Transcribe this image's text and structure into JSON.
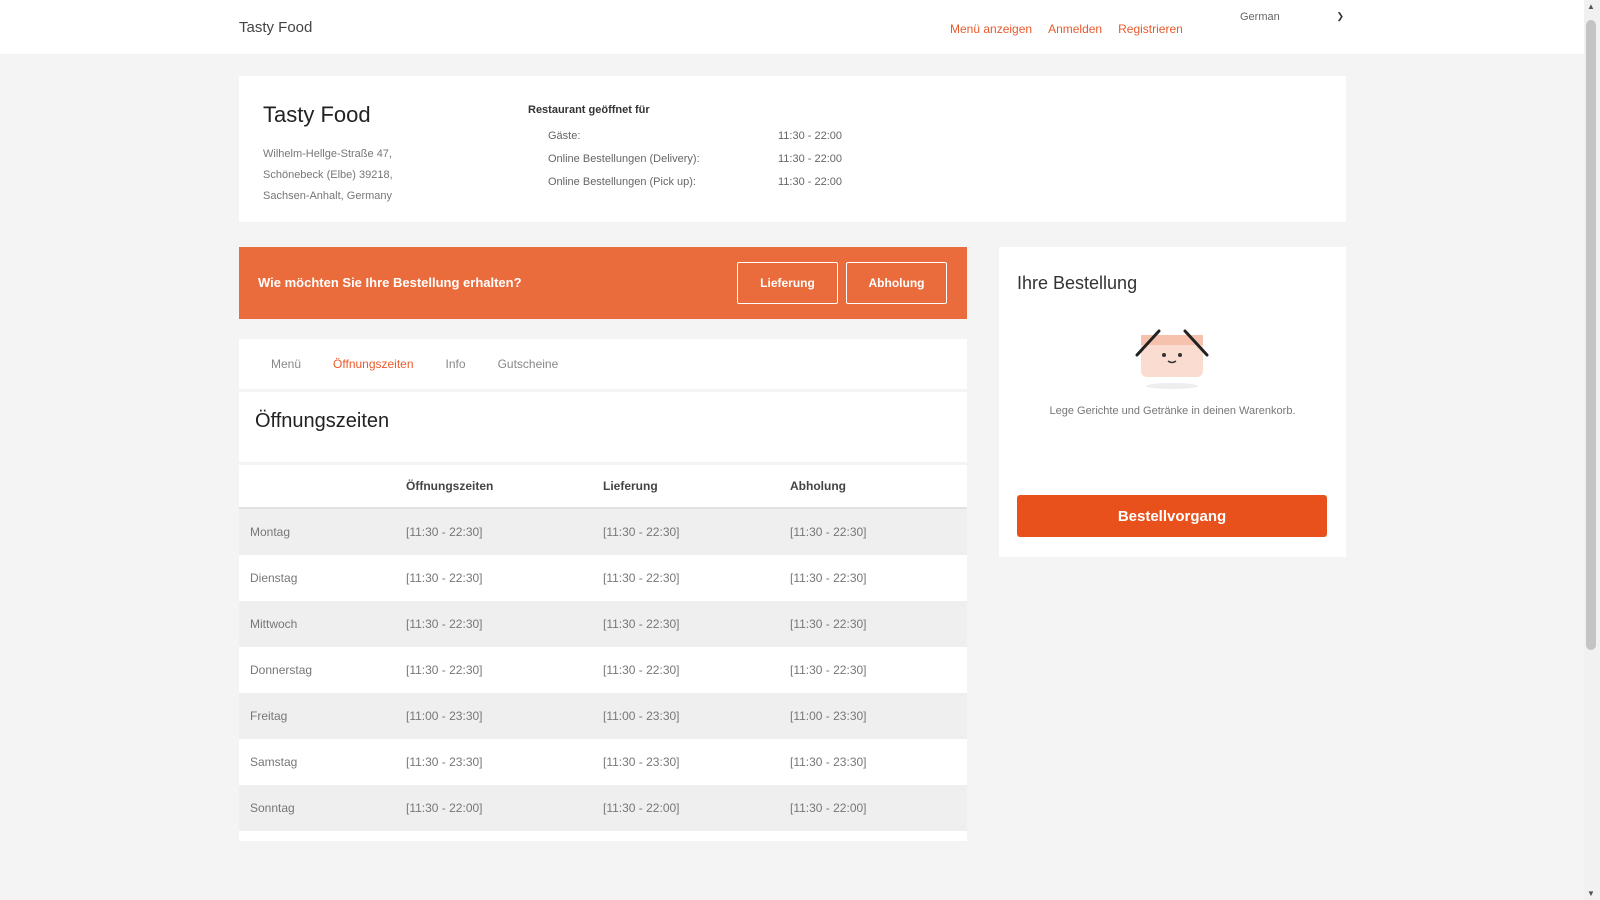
{
  "nav": {
    "brand": "Tasty Food",
    "links": [
      "Menü anzeigen",
      "Anmelden",
      "Registrieren"
    ],
    "language": "German"
  },
  "restaurant": {
    "name": "Tasty Food",
    "address_lines": [
      "Wilhelm-Hellge-Straße 47,",
      "Schönebeck (Elbe) 39218,",
      "Sachsen-Anhalt, Germany"
    ],
    "hours_heading": "Restaurant geöffnet für",
    "hours": [
      {
        "label": "Gäste:",
        "time": "11:30 - 22:00"
      },
      {
        "label": "Online Bestellungen (Delivery):",
        "time": "11:30 - 22:00"
      },
      {
        "label": "Online Bestellungen (Pick up):",
        "time": "11:30 - 22:00"
      }
    ]
  },
  "banner": {
    "question": "Wie möchten Sie Ihre Bestellung erhalten?",
    "delivery_label": "Lieferung",
    "pickup_label": "Abholung",
    "color": "#ea6b3b"
  },
  "tabs": {
    "items": [
      "Menü",
      "Öffnungszeiten",
      "Info",
      "Gutscheine"
    ],
    "active": "Öffnungszeiten"
  },
  "schedule": {
    "title": "Öffnungszeiten",
    "headers": [
      "",
      "Öffnungszeiten",
      "Lieferung",
      "Abholung"
    ],
    "rows": [
      [
        "Montag",
        "[11:30 - 22:30]",
        "[11:30 - 22:30]",
        "[11:30 - 22:30]"
      ],
      [
        "Dienstag",
        "[11:30 - 22:30]",
        "[11:30 - 22:30]",
        "[11:30 - 22:30]"
      ],
      [
        "Mittwoch",
        "[11:30 - 22:30]",
        "[11:30 - 22:30]",
        "[11:30 - 22:30]"
      ],
      [
        "Donnerstag",
        "[11:30 - 22:30]",
        "[11:30 - 22:30]",
        "[11:30 - 22:30]"
      ],
      [
        "Freitag",
        "[11:00 - 23:30]",
        "[11:00 - 23:30]",
        "[11:00 - 23:30]"
      ],
      [
        "Samstag",
        "[11:30 - 23:30]",
        "[11:30 - 23:30]",
        "[11:30 - 23:30]"
      ],
      [
        "Sonntag",
        "[11:30 - 22:00]",
        "[11:30 - 22:00]",
        "[11:30 - 22:00]"
      ]
    ]
  },
  "order": {
    "heading": "Ihre Bestellung",
    "empty_text": "Lege Gerichte und Getränke in deinen Warenkorb.",
    "checkout_label": "Bestellvorgang",
    "basket_icon": "empty-basket-icon",
    "accent": "#e8501c"
  }
}
